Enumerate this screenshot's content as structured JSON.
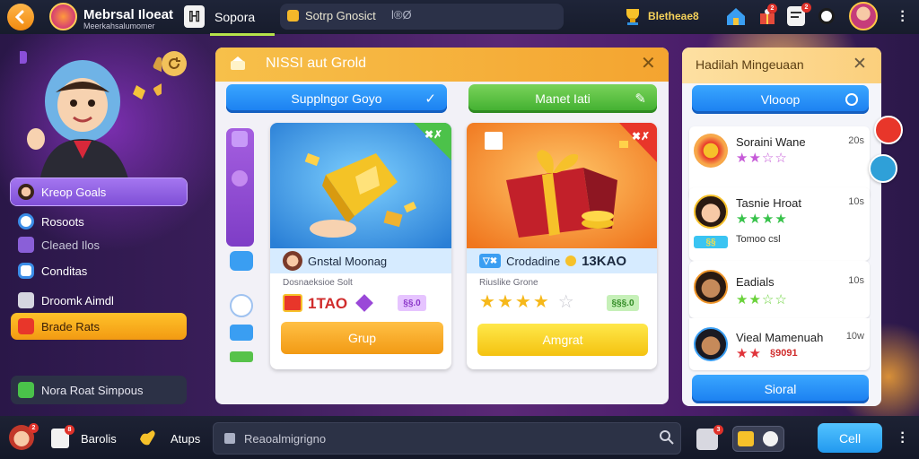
{
  "header": {
    "title": "Mebrsal Iloeat",
    "subtitle": "Meerkahsalumomer",
    "nav_label": "Sopora",
    "search_text": "Sotrp Gnosict",
    "search_suffix": "l®Ø",
    "coins": "Bletheae8",
    "notif_count_1": "2",
    "notif_count_2": "2"
  },
  "sidebar": {
    "items": [
      {
        "label": "Kreop Goals",
        "icon": "avatar-icon"
      },
      {
        "label": "Rosoots",
        "icon": "person-icon"
      },
      {
        "label": "Cleaed Ilos",
        "icon": "puzzle-icon"
      },
      {
        "label": "Conditas",
        "icon": "chat-icon"
      },
      {
        "label": "Droomk Aimdl",
        "icon": "cube-icon"
      },
      {
        "label": "Brade Rats",
        "icon": "card-icon"
      }
    ],
    "footer_label": "Nora Roat Simpous"
  },
  "main_panel": {
    "title": "NISSI aut Grold",
    "primary_button": "Supplngor Goyo",
    "secondary_button": "Manet Iati",
    "cards": [
      {
        "corner_tag": "✖✗",
        "band_label": "Gnstal Moonag",
        "sub_label": "Dosnaeksioe Solt",
        "value": "1TAO",
        "pill": "§§.0",
        "cta": "Grup",
        "cta_color": "#f4a21e"
      },
      {
        "corner_tag": "✖✗",
        "band_tag": "▽✖",
        "band_label": "Crodadine",
        "band_value": "13KAO",
        "sub_label": "Riuslike Grone",
        "stars": 4,
        "pill": "§§§.0",
        "cta": "Amgrat",
        "cta_color": "#f6d21a"
      }
    ]
  },
  "right_panel": {
    "title": "Hadilah Mingeuaan",
    "button": "Vlooop",
    "entries": [
      {
        "name": "Soraini Wane",
        "time": "20s",
        "stars": "★★☆☆",
        "star_color": "#c65ad8"
      },
      {
        "name": "Tasnie Hroat",
        "time": "10s",
        "stars": "★★★★",
        "star_color": "#37c24a",
        "tag": "§§",
        "extra": "Tomoo csl"
      },
      {
        "name": "Eadials",
        "time": "10s",
        "stars": "★★☆☆",
        "star_color": "#6ad23a"
      },
      {
        "name": "Vieal Mamenuah",
        "time": "10w",
        "stars": "★★",
        "star_color": "#e0333a",
        "extra": "§9091"
      }
    ],
    "footer_button": "Sioral"
  },
  "bottom": {
    "notif_count": "2",
    "badge_count": "8",
    "badge_count_2": "3",
    "item1": "Barolis",
    "item2": "Atups",
    "search_placeholder": "Reaoalmigrigno",
    "call_button": "Cell"
  },
  "colors": {
    "accent_orange": "#f4a430",
    "accent_blue": "#1a7ef0",
    "accent_green": "#3fae2e",
    "accent_purple": "#8b57e0"
  }
}
